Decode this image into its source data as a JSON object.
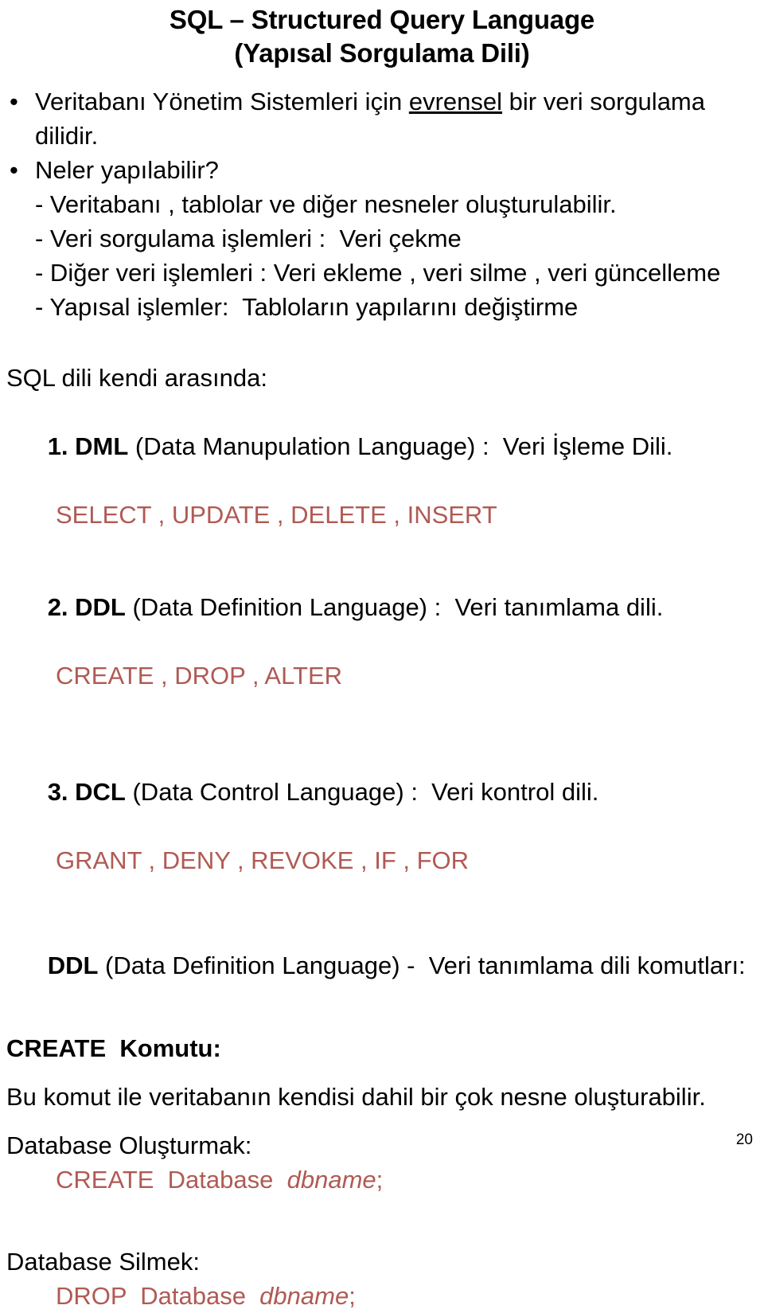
{
  "document": {
    "title_lines": [
      "SQL – Structured Query Language",
      "(Yapısal Sorgulama Dili)"
    ],
    "page_number": "20",
    "accent_color": "#b05a54",
    "text_color": "#000000",
    "background_color": "#ffffff"
  },
  "bullets": {
    "bullet_glyph": "•",
    "item1_pre": "Veritabanı Yönetim Sistemleri için ",
    "item1_underlined": "evrensel",
    "item1_post": " bir veri sorgulama",
    "item1_wrap": "dilidir.",
    "item2": "Neler yapılabilir?"
  },
  "capabilities": [
    "- Veritabanı , tablolar ve diğer nesneler oluşturulabilir.",
    "- Veri sorgulama işlemleri :  Veri çekme",
    "- Diğer veri işlemleri : Veri ekleme , veri silme , veri güncelleme",
    "- Yapısal işlemler:  Tabloların yapılarını değiştirme"
  ],
  "sublanguages": {
    "heading": "SQL dili kendi arasında:",
    "items": [
      {
        "number_and_abbr": "1. DML",
        "expansion": " (Data Manupulation Language) :  Veri İşleme Dili.",
        "commands": "SELECT , UPDATE , DELETE , INSERT"
      },
      {
        "number_and_abbr": "2. DDL",
        "expansion": " (Data Definition Language) :  Veri tanımlama dili.",
        "commands": "CREATE , DROP , ALTER"
      },
      {
        "number_and_abbr": "3. DCL",
        "expansion": " (Data Control Language) :  Veri kontrol dili.",
        "commands": "GRANT , DENY , REVOKE , IF , FOR"
      }
    ]
  },
  "ddl_section": {
    "heading_bold": "DDL",
    "heading_rest": " (Data Definition Language) -  Veri tanımlama dili komutları:",
    "create_heading": "CREATE  Komutu:",
    "description": "Bu komut ile veritabanın kendisi dahil bir çok nesne oluşturabilir.",
    "create_db_label": "Database Oluşturmak:",
    "create_db_cmd_pre": "CREATE  Database  ",
    "create_db_cmd_italic": "dbname",
    "create_db_cmd_post": ";",
    "drop_db_label": "Database Silmek:",
    "drop_db_cmd_pre": "DROP  Database  ",
    "drop_db_cmd_italic": "dbname",
    "drop_db_cmd_post": ";"
  }
}
